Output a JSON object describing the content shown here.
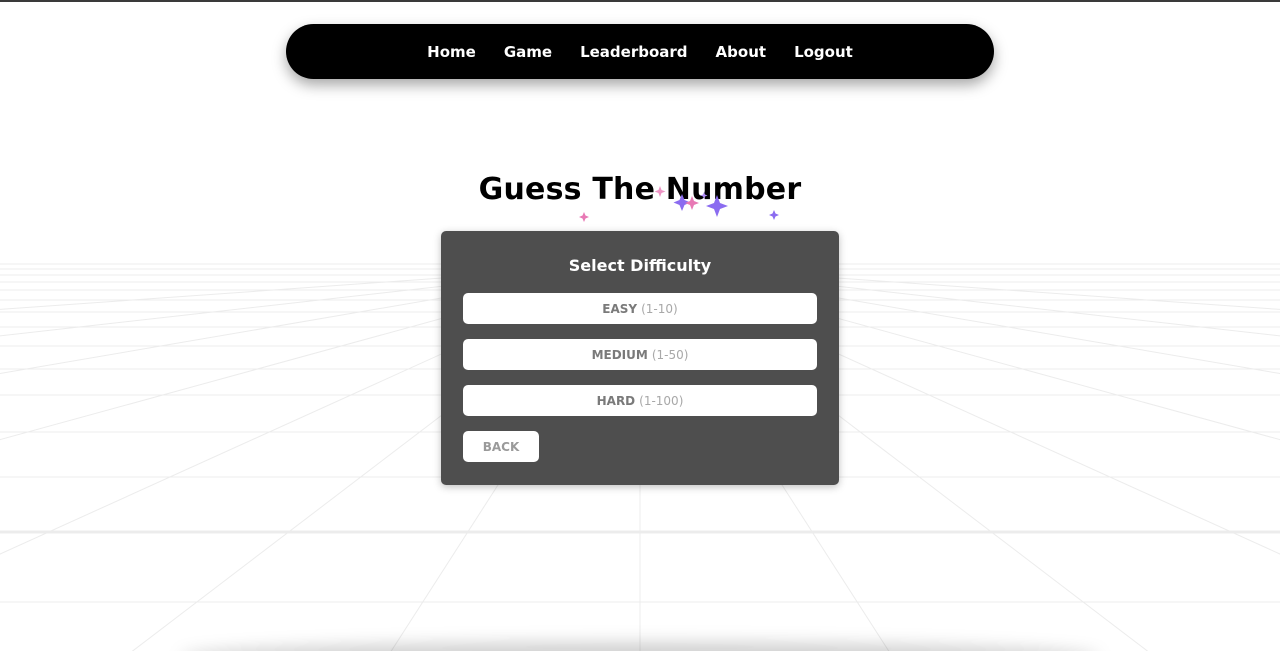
{
  "nav": {
    "items": [
      {
        "label": "Home"
      },
      {
        "label": "Game"
      },
      {
        "label": "Leaderboard"
      },
      {
        "label": "About"
      },
      {
        "label": "Logout"
      }
    ]
  },
  "title": "Guess The Number",
  "card": {
    "heading": "Select Difficulty",
    "difficulties": [
      {
        "name": "EASY",
        "range": "(1-10)"
      },
      {
        "name": "MEDIUM",
        "range": "(1-50)"
      },
      {
        "name": "HARD",
        "range": "(1-100)"
      }
    ],
    "back_label": "BACK"
  },
  "colors": {
    "nav_bg": "#000000",
    "card_bg": "#4e4e4e",
    "sparkle_pink": "#e879b5",
    "sparkle_purple": "#8b6cf0"
  }
}
